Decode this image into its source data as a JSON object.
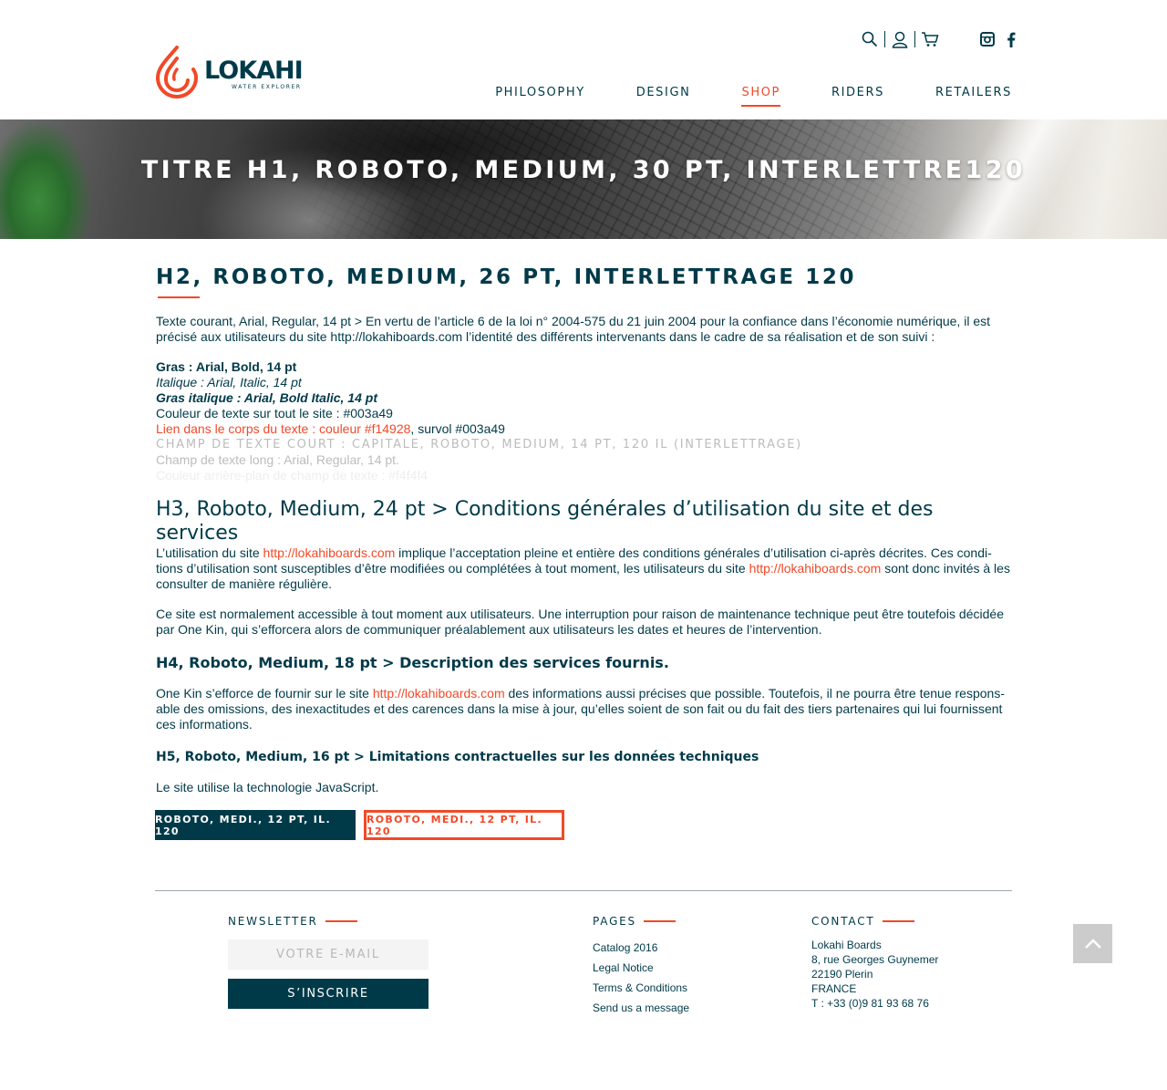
{
  "brand": {
    "name": "LOKAHI",
    "tagline": "WATER EXPLORER",
    "colors": {
      "primary": "#003a49",
      "accent": "#f14928",
      "field_bg": "#f4f4f4"
    }
  },
  "header": {
    "tools": [
      "search-icon",
      "user-icon",
      "cart-icon"
    ],
    "social": [
      "instagram-icon",
      "facebook-icon"
    ],
    "nav": [
      {
        "label": "PHILOSOPHY",
        "active": false
      },
      {
        "label": "DESIGN",
        "active": false
      },
      {
        "label": "SHOP",
        "active": true
      },
      {
        "label": "RIDERS",
        "active": false
      },
      {
        "label": "RETAILERS",
        "active": false
      }
    ]
  },
  "hero": {
    "title": "TITRE H1, ROBOTO, MEDIUM, 30 PT, INTERLETTRE120"
  },
  "content": {
    "h2": "H2, ROBOTO, MEDIUM, 26 PT, INTERLETTRAGE 120",
    "intro": "Texte courant, Arial, Regular, 14 pt > En vertu de l’article 6 de la loi n° 2004-575 du 21 juin 2004 pour la confiance dans l’économie numérique, il est précisé aux utilisateurs du site http://lokahiboards.com l’identité des différents intervenants dans le cadre de sa réalisation et de son suivi :",
    "bold": "Gras : Arial, Bold, 14 pt",
    "italic": "Italique : Arial, Italic, 14 pt",
    "bold_italic": "Gras italique : Arial, Bold Italic, 14 pt",
    "text_color": "Couleur de texte sur tout le site : #003a49",
    "link_text": "Lien dans le corps du texte : couleur #f14928",
    "link_hover": ", survol #003a49",
    "short_field": "CHAMP DE TEXTE COURT : CAPITALE, ROBOTO, MEDIUM, 14 PT, 120 IL (INTERLETTRAGE)",
    "long_field": "Champ de texte long : Arial, Regular, 14 pt.",
    "field_bg": "Couleur arrière-plan de champ de texte : #f4f4f4",
    "h3": "H3, Roboto, Medium, 24 pt > Conditions générales d’utilisation du site et des services",
    "p1_a": "L’utilisation du site ",
    "p1_link1": "http://lokahiboards.com",
    "p1_b": " implique l’acceptation pleine et entière des conditions générales d’utilisation ci-après décrites. Ces condi­tions d’utilisation sont susceptibles d’être modifiées ou complétées à tout moment, les utilisateurs du site ",
    "p1_link2": "http://lokahiboards.com",
    "p1_c": " sont donc invités à les consulter de manière régulière.",
    "p2": "Ce site est normalement accessible à tout moment aux utilisateurs. Une interruption pour raison de maintenance technique peut être toutefois décidée par One Kin, qui s’efforcera alors de communiquer préalablement aux utilisateurs les dates et heures de l’intervention.",
    "h4": "H4, Roboto, Medium, 18 pt > Description des services fournis.",
    "p3_a": "One Kin s’efforce de fournir sur le site ",
    "p3_link": "http://lokahiboards.com",
    "p3_b": " des informations aussi précises que possible. Toutefois, il ne pourra être tenue respons­able des omissions, des inexactitudes et des carences dans la mise à jour, qu’elles soient de son fait ou du fait des tiers partenaires qui lui fournissent ces informations.",
    "h5": "H5, Roboto, Medium, 16 pt >  Limitations contractuelles sur les données techniques",
    "p4": "Le site utilise la technologie JavaScript.",
    "btn_dark": "ROBOTO, MEDI., 12 PT, IL. 120",
    "btn_outline": "ROBOTO, MEDI., 12 PT, IL. 120"
  },
  "footer": {
    "newsletter": {
      "heading": "NEWSLETTER",
      "placeholder": "VOTRE E-MAIL",
      "button": "S’INSCRIRE"
    },
    "pages": {
      "heading": "PAGES",
      "links": [
        "Catalog 2016",
        "Legal Notice",
        "Terms & Conditions",
        "Send us a message"
      ]
    },
    "contact": {
      "heading": "CONTACT",
      "lines": [
        "Lokahi Boards",
        "8, rue Georges Guynemer",
        "22190 Plerin",
        "FRANCE",
        "T : +33 (0)9 81 93 68 76"
      ]
    }
  }
}
